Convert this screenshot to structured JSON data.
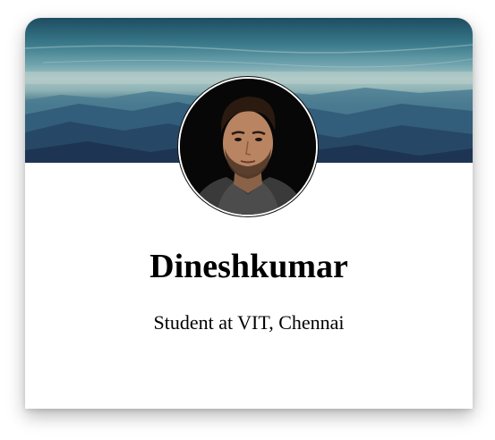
{
  "profile": {
    "name": "Dineshkumar",
    "subtitle": "Student at VIT, Chennai"
  },
  "images": {
    "banner": "mountain-landscape-banner",
    "avatar": "profile-photo"
  }
}
